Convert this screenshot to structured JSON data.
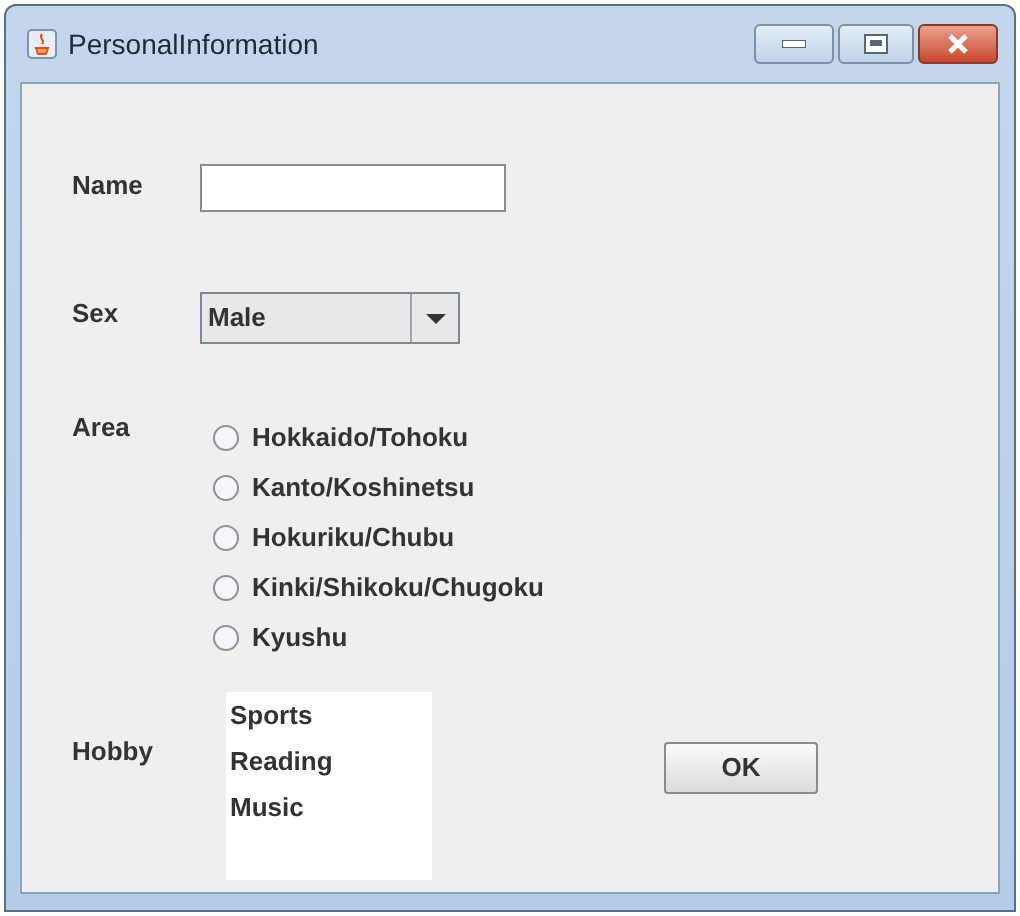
{
  "window": {
    "title": "PersonalInformation"
  },
  "name": {
    "label": "Name"
  },
  "sex": {
    "label": "Sex",
    "value": "Male"
  },
  "area": {
    "label": "Area",
    "options": [
      {
        "label": "Hokkaido/Tohoku",
        "selected": false
      },
      {
        "label": "Kanto/Koshinetsu",
        "selected": false
      },
      {
        "label": "Hokuriku/Chubu",
        "selected": false
      },
      {
        "label": "Kinki/Shikoku/Chugoku",
        "selected": false
      },
      {
        "label": "Kyushu",
        "selected": false
      }
    ]
  },
  "hobby": {
    "label": "Hobby",
    "items": [
      "Sports",
      "Reading",
      "Music"
    ]
  },
  "buttons": [
    "OK"
  ]
}
